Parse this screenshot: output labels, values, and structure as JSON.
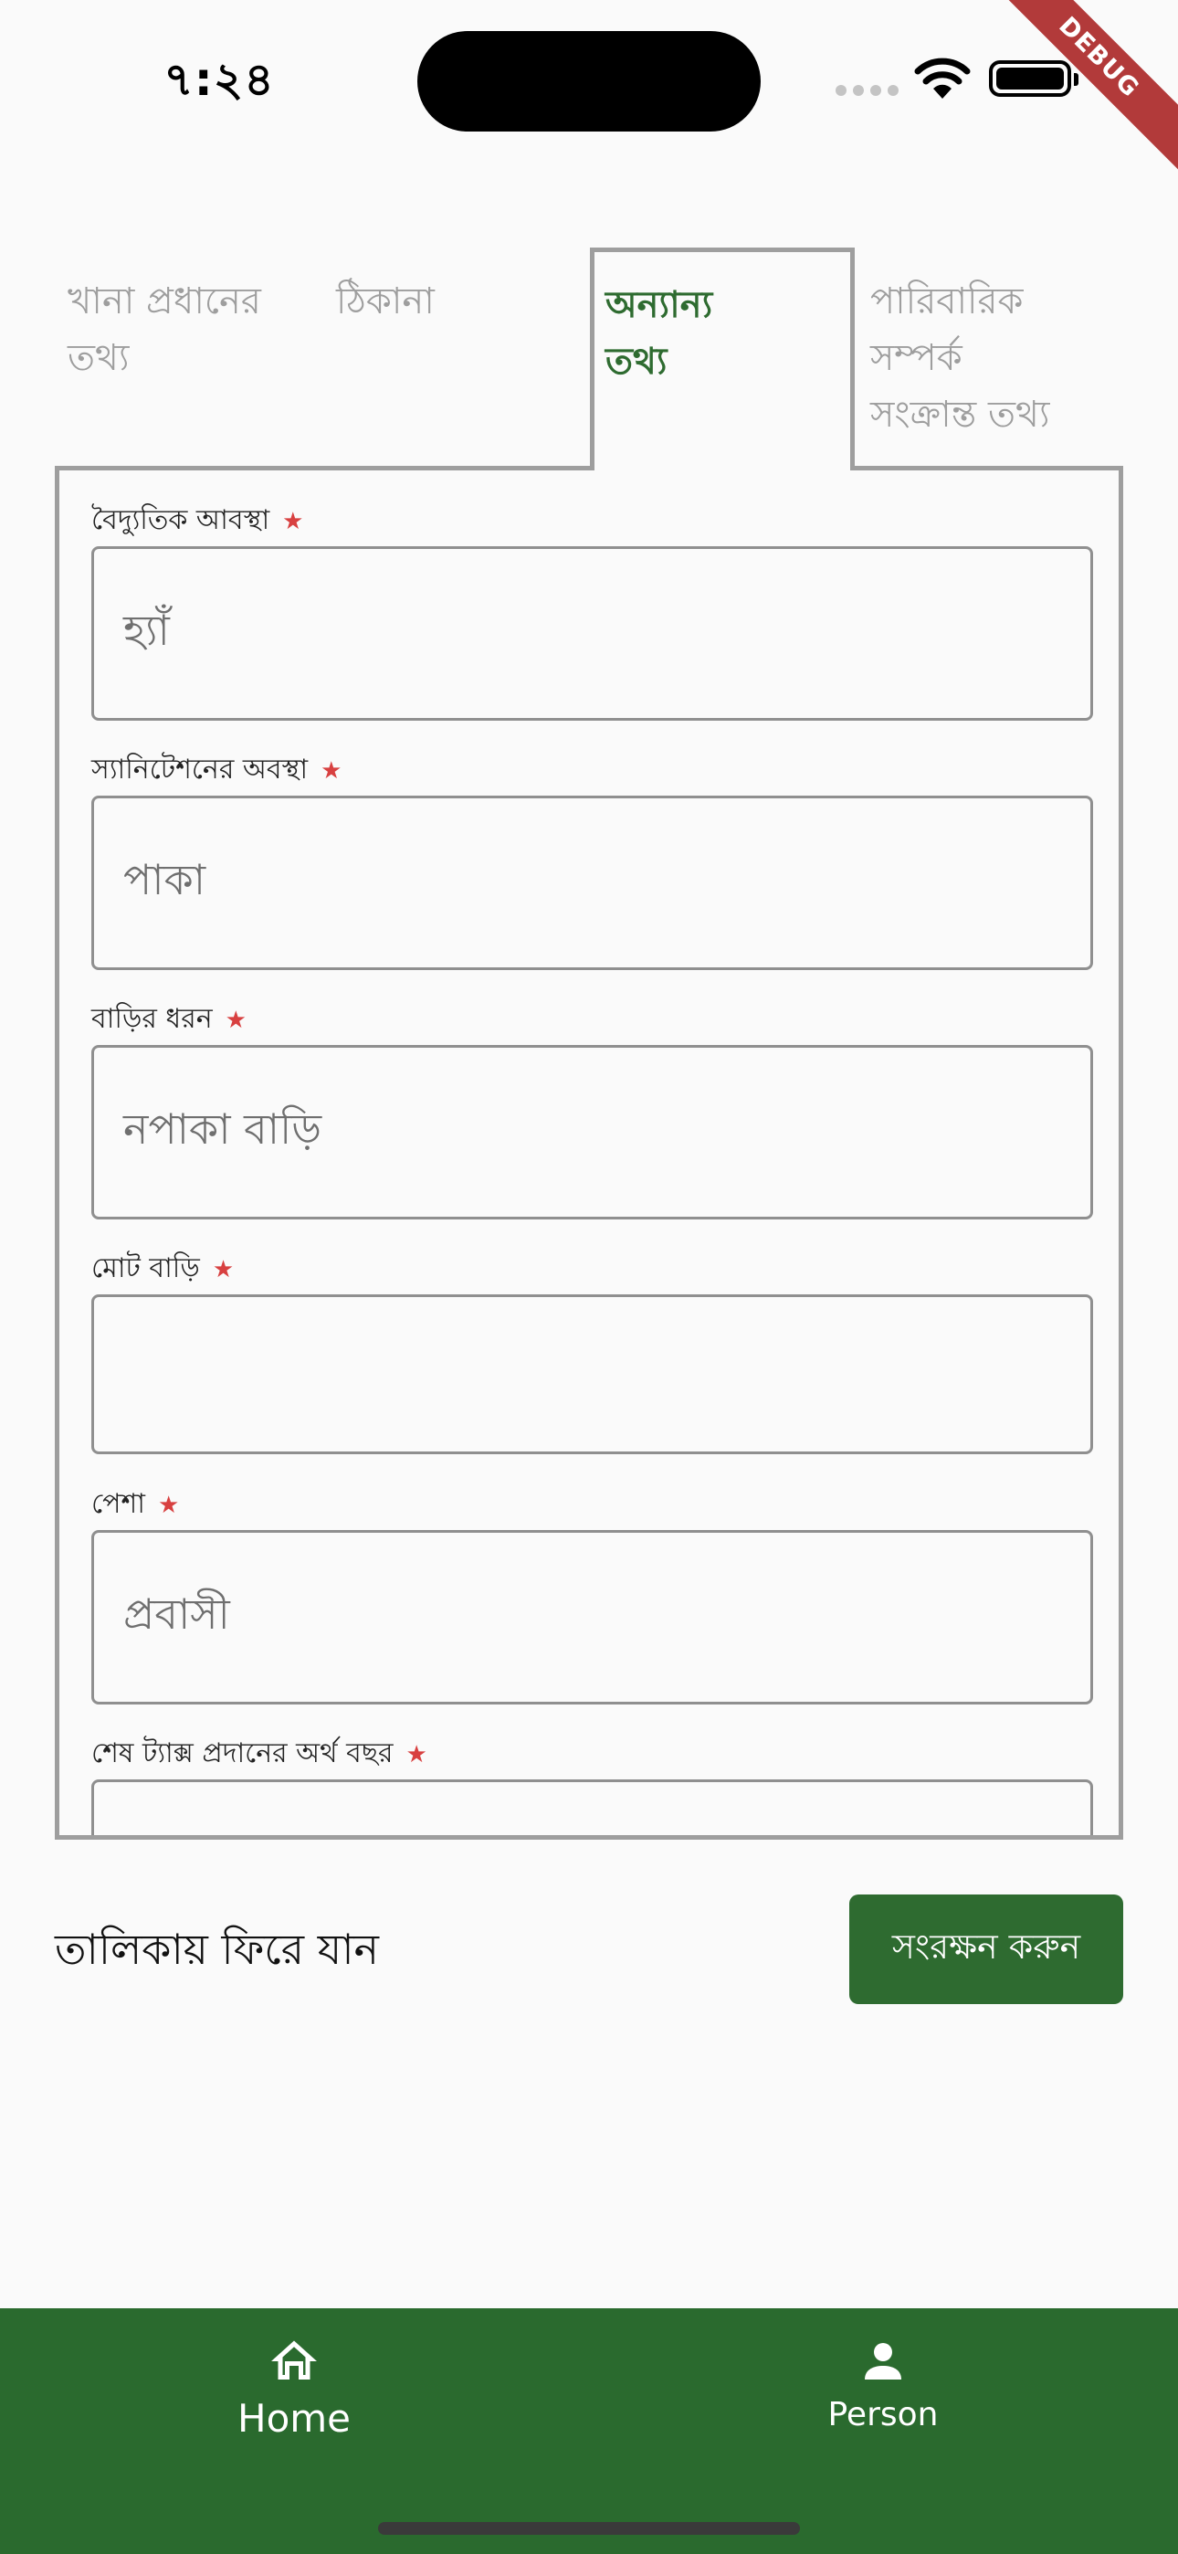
{
  "status_bar": {
    "time": "৭:২৪",
    "debug_label": "DEBUG"
  },
  "tabs": [
    {
      "line1": "খানা প্রধানের",
      "line2": "তথ্য",
      "line3": "",
      "active": false
    },
    {
      "line1": "ঠিকানা",
      "line2": "",
      "line3": "",
      "active": false
    },
    {
      "line1": "অন্যান্য",
      "line2": "তথ্য",
      "line3": "",
      "active": true
    },
    {
      "line1": "পারিবারিক",
      "line2": "সম্পর্ক",
      "line3": "সংক্রান্ত তথ্য",
      "active": false
    }
  ],
  "form": {
    "fields": [
      {
        "label": "বৈদ্যুতিক আবস্থা",
        "required": true,
        "value": "হ্যাঁ"
      },
      {
        "label": "স্যানিটেশনের অবস্থা",
        "required": true,
        "value": "পাকা"
      },
      {
        "label": "বাড়ির ধরন",
        "required": true,
        "value": "নপাকা বাড়ি"
      },
      {
        "label": "মোট বাড়ি",
        "required": true,
        "value": ""
      },
      {
        "label": "পেশা",
        "required": true,
        "value": "প্রবাসী"
      },
      {
        "label": "শেষ ট্যাক্স প্রদানের অর্থ বছর",
        "required": true,
        "value": ""
      }
    ],
    "required_marker": "★"
  },
  "actions": {
    "back_label": "তালিকায় ফিরে যান",
    "save_label": "সংরক্ষন করুন"
  },
  "bottom_nav": {
    "items": [
      {
        "label": "Home",
        "icon": "home-icon"
      },
      {
        "label": "Person",
        "icon": "person-icon"
      }
    ]
  },
  "colors": {
    "accent": "#2e6b30",
    "nav_background": "#2a6a2e",
    "required_star": "#d84040",
    "inactive_tab": "#9e9e9e"
  }
}
